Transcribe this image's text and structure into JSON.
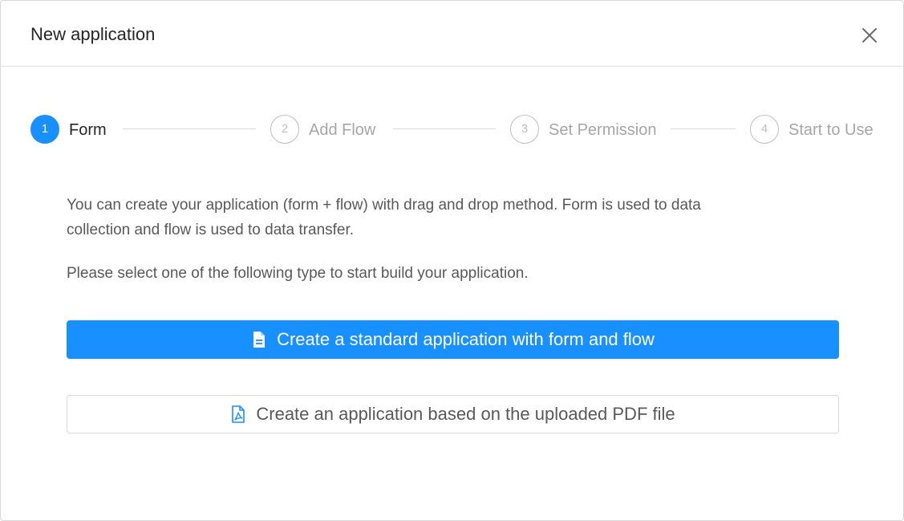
{
  "modal": {
    "title": "New application",
    "close_icon": "close-icon"
  },
  "steps": [
    {
      "number": "1",
      "label": "Form",
      "status": "active"
    },
    {
      "number": "2",
      "label": "Add Flow",
      "status": "wait"
    },
    {
      "number": "3",
      "label": "Set Permission",
      "status": "wait"
    },
    {
      "number": "4",
      "label": "Start to Use",
      "status": "wait"
    }
  ],
  "content": {
    "description_line1": "You can create your application (form + flow) with drag and drop method. Form is used to data",
    "description_line2": "collection and flow is used to data transfer.",
    "instruction": "Please select one of the following type to start build your application."
  },
  "buttons": {
    "standard_label": "Create a standard application with form and flow",
    "standard_icon": "file-text-icon",
    "pdf_label": "Create an application based on the uploaded PDF file",
    "pdf_icon": "file-pdf-icon"
  },
  "colors": {
    "primary": "#1890ff",
    "text": "#262626",
    "muted": "#a6a6a6",
    "border": "#d9d9d9"
  }
}
